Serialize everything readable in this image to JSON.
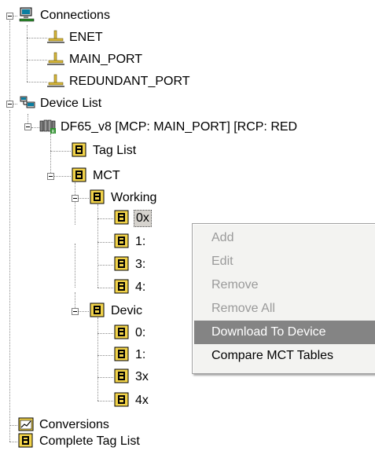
{
  "tree": {
    "connections": {
      "label": "Connections",
      "children": [
        "ENET",
        "MAIN_PORT",
        "REDUNDANT_PORT"
      ]
    },
    "device_list": {
      "label": "Device List",
      "device": {
        "label": "DF65_v8 [MCP: MAIN_PORT] [RCP: RED",
        "tag_list": "Tag List",
        "mct": {
          "label": "MCT",
          "working": {
            "label": "Working",
            "children": [
              "0x",
              "1:",
              "3:",
              "4:"
            ]
          },
          "device": {
            "label": "Devic",
            "children": [
              "0:",
              "1:",
              "3x",
              "4x"
            ]
          }
        }
      }
    },
    "conversions": "Conversions",
    "complete_tag_list": "Complete Tag List"
  },
  "context_menu": {
    "items": [
      {
        "label": "Add",
        "enabled": false
      },
      {
        "label": "Edit",
        "enabled": false
      },
      {
        "label": "Remove",
        "enabled": false
      },
      {
        "label": "Remove All",
        "enabled": false
      },
      {
        "label": "Download To Device",
        "enabled": true,
        "highlighted": true
      },
      {
        "label": "Compare MCT Tables",
        "enabled": true
      }
    ]
  },
  "colors": {
    "selection_bg": "#848484",
    "disabled_text": "#9a9a9a",
    "menu_bg": "#f3f3f1",
    "book_icon_yellow": "#f2d34a",
    "tree_line": "#8c8c8c"
  },
  "icons": {
    "connections": "network-computer-icon",
    "port": "port-connector-icon",
    "device_list": "device-list-icon",
    "device": "plc-device-icon",
    "table": "table-book-icon",
    "conversions": "conversion-chart-icon"
  }
}
